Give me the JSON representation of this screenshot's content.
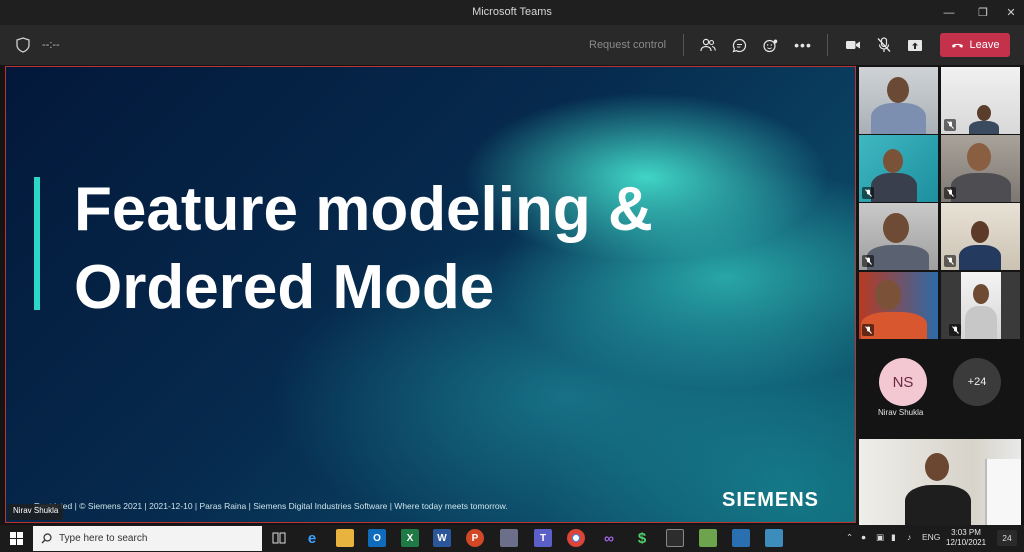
{
  "window": {
    "title": "Microsoft Teams"
  },
  "toolbar": {
    "timer": "--:--",
    "request_control": "Request control",
    "leave_label": "Leave"
  },
  "slide": {
    "title_line1": "Feature modeling &",
    "title_line2": "Ordered Mode",
    "footer": "Restricted | © Siemens 2021 | 2021-12-10 | Paras Raina | Siemens Digital Industries Software | Where today meets tomorrow.",
    "logo": "SIEMENS",
    "presenter_name": "Nirav Shukla"
  },
  "participants": {
    "avatar_initials": "NS",
    "avatar_name": "Nirav Shukla",
    "more_count": "+24"
  },
  "taskbar": {
    "search_placeholder": "Type here to search",
    "language": "ENG",
    "time": "3:03 PM",
    "date": "12/10/2021",
    "notification_count": "24"
  },
  "colors": {
    "leave": "#c4314b",
    "accent": "#2bd8c7",
    "avatar_bg": "#f4c8d2"
  }
}
